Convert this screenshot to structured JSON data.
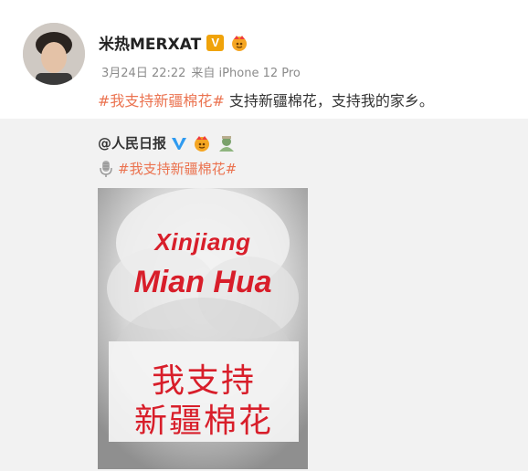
{
  "post": {
    "author": "米热MERXAT",
    "verified_label": "V",
    "timestamp": "3月24日 22:22",
    "source": "来自 iPhone 12 Pro",
    "hashtag": "#我支持新疆棉花#",
    "text": " 支持新疆棉花，支持我的家乡。"
  },
  "repost": {
    "author": "@人民日报",
    "hashtag": "#我支持新疆棉花#",
    "image": {
      "title_line1": "Xinjiang",
      "title_line2": "Mian Hua",
      "caption_line1": "我支持",
      "caption_line2": "新疆棉花"
    }
  },
  "colors": {
    "hashtag": "#eb7350",
    "accent_red": "#d81e2a",
    "verified_orange": "#f0a30a",
    "verified_blue": "#2f9bf0"
  },
  "icons": {
    "verified": "verified-v-icon",
    "fan": "fan-badge-icon",
    "mic": "microphone-icon",
    "green": "green-badge-icon"
  }
}
